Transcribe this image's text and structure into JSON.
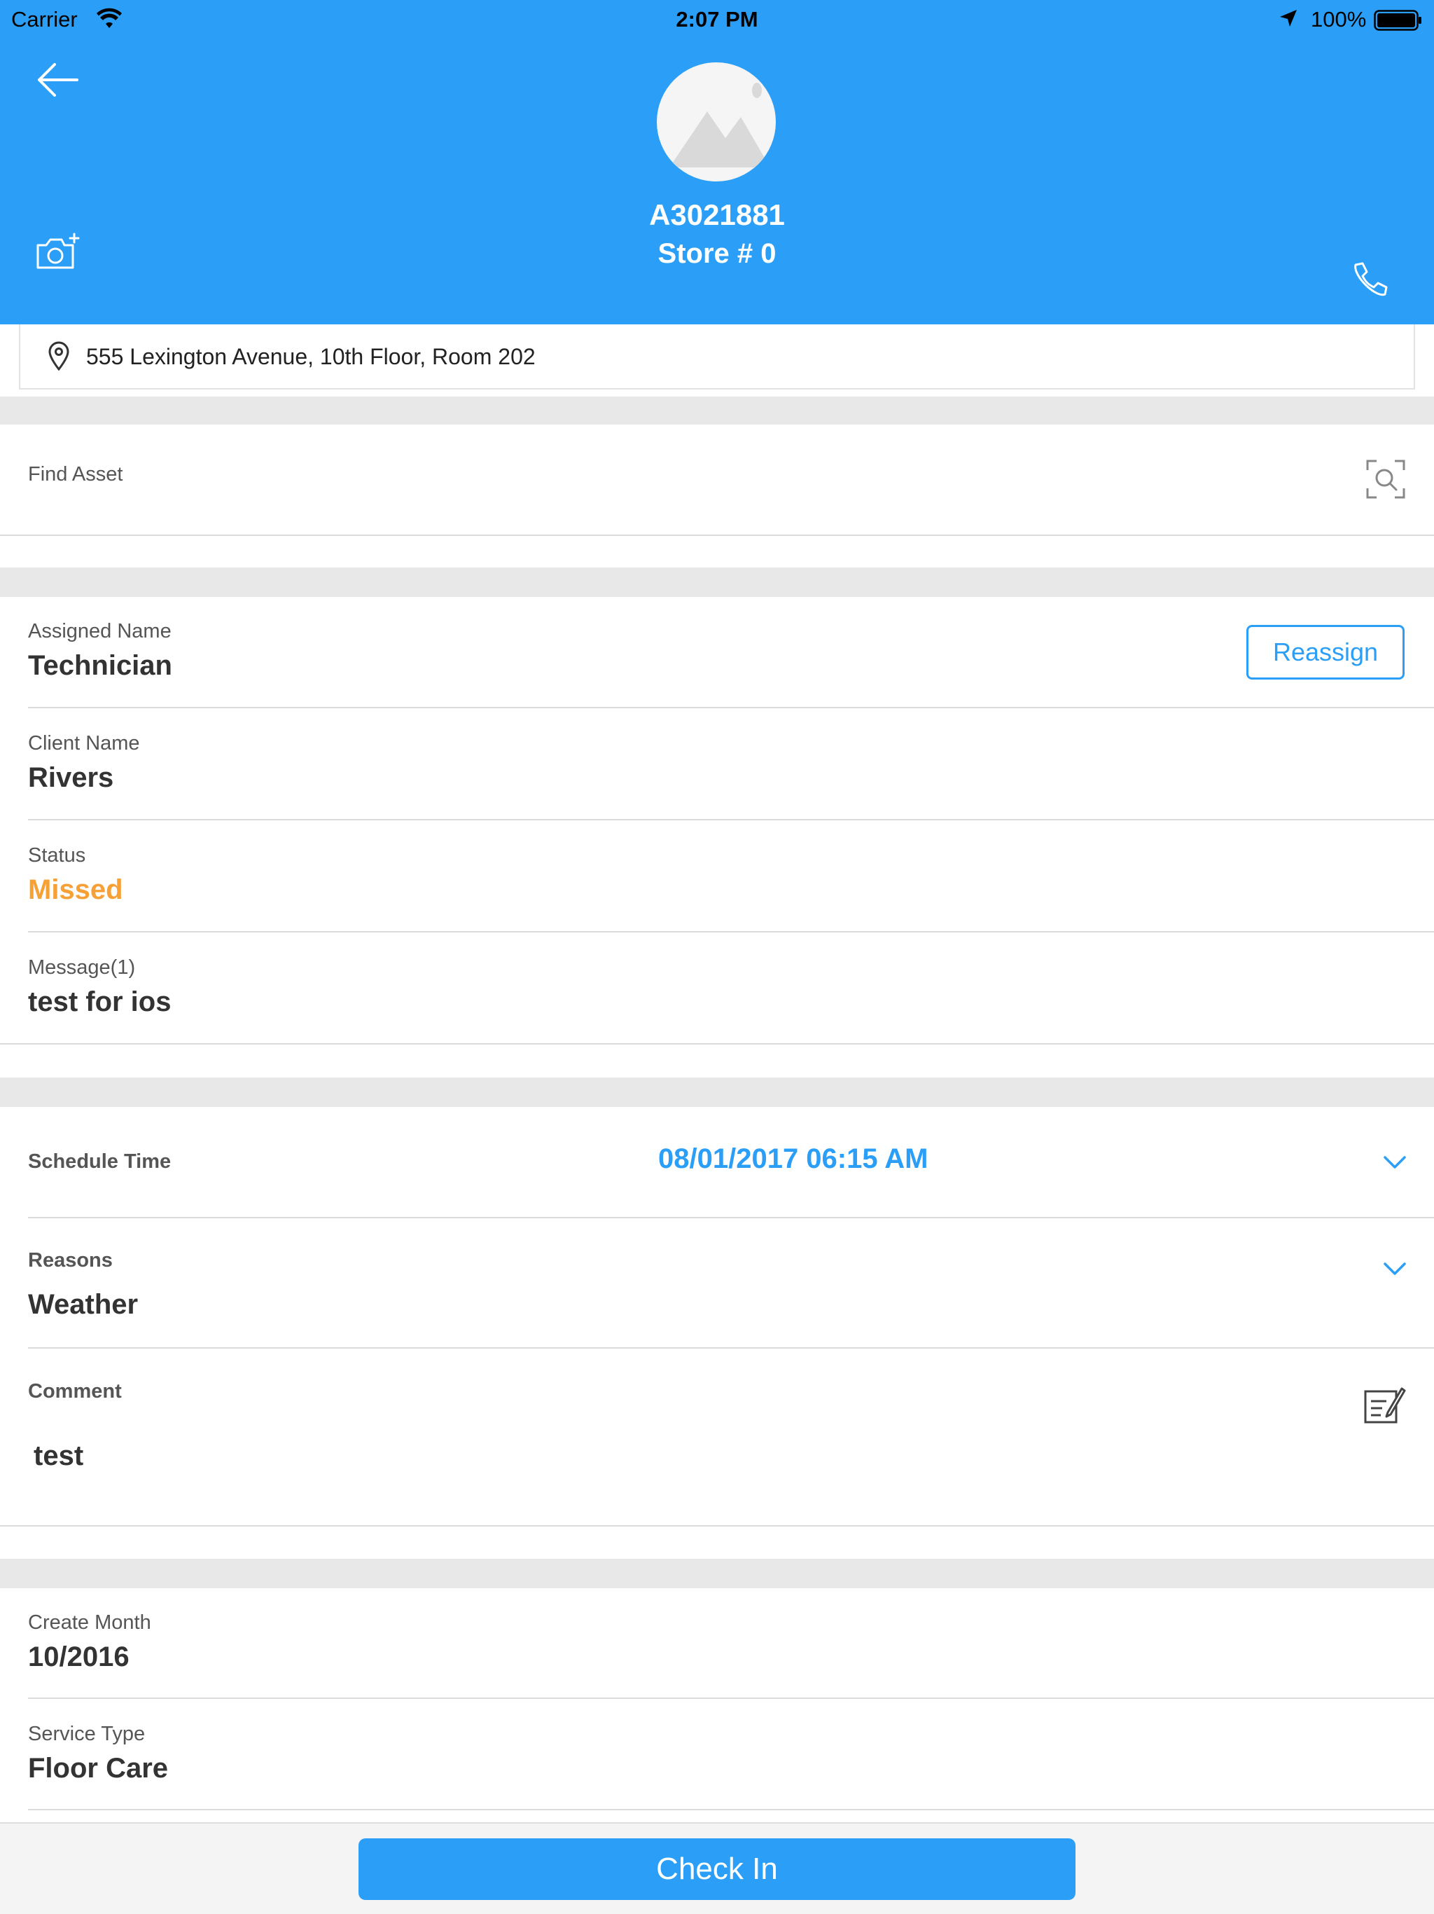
{
  "status_bar": {
    "carrier": "Carrier",
    "time": "2:07 PM",
    "battery": "100%"
  },
  "header": {
    "title": "A3021881",
    "subtitle": "Store # 0"
  },
  "address": "555 Lexington Avenue, 10th Floor, Room 202",
  "find_asset": {
    "label": "Find Asset"
  },
  "assigned": {
    "label": "Assigned Name",
    "value": "Technician",
    "button": "Reassign"
  },
  "client": {
    "label": "Client Name",
    "value": "Rivers"
  },
  "status": {
    "label": "Status",
    "value": "Missed",
    "color": "#f7a035"
  },
  "message": {
    "label": "Message(1)",
    "value": "test for ios"
  },
  "schedule": {
    "label": "Schedule Time",
    "value": "08/01/2017 06:15 AM"
  },
  "reasons": {
    "label": "Reasons",
    "value": "Weather"
  },
  "comment": {
    "label": "Comment",
    "value": "test"
  },
  "create_month": {
    "label": "Create Month",
    "value": "10/2016"
  },
  "service_type": {
    "label": "Service Type",
    "value": "Floor Care"
  },
  "footer": {
    "button": "Check In"
  },
  "colors": {
    "primary": "#2b9ff7",
    "background": "#ffffff",
    "divider": "#e8e8e8"
  },
  "icons": [
    "back-arrow-icon",
    "camera-add-icon",
    "phone-icon",
    "location-pin-icon",
    "scan-search-icon",
    "chevron-down-icon",
    "edit-note-icon"
  ]
}
